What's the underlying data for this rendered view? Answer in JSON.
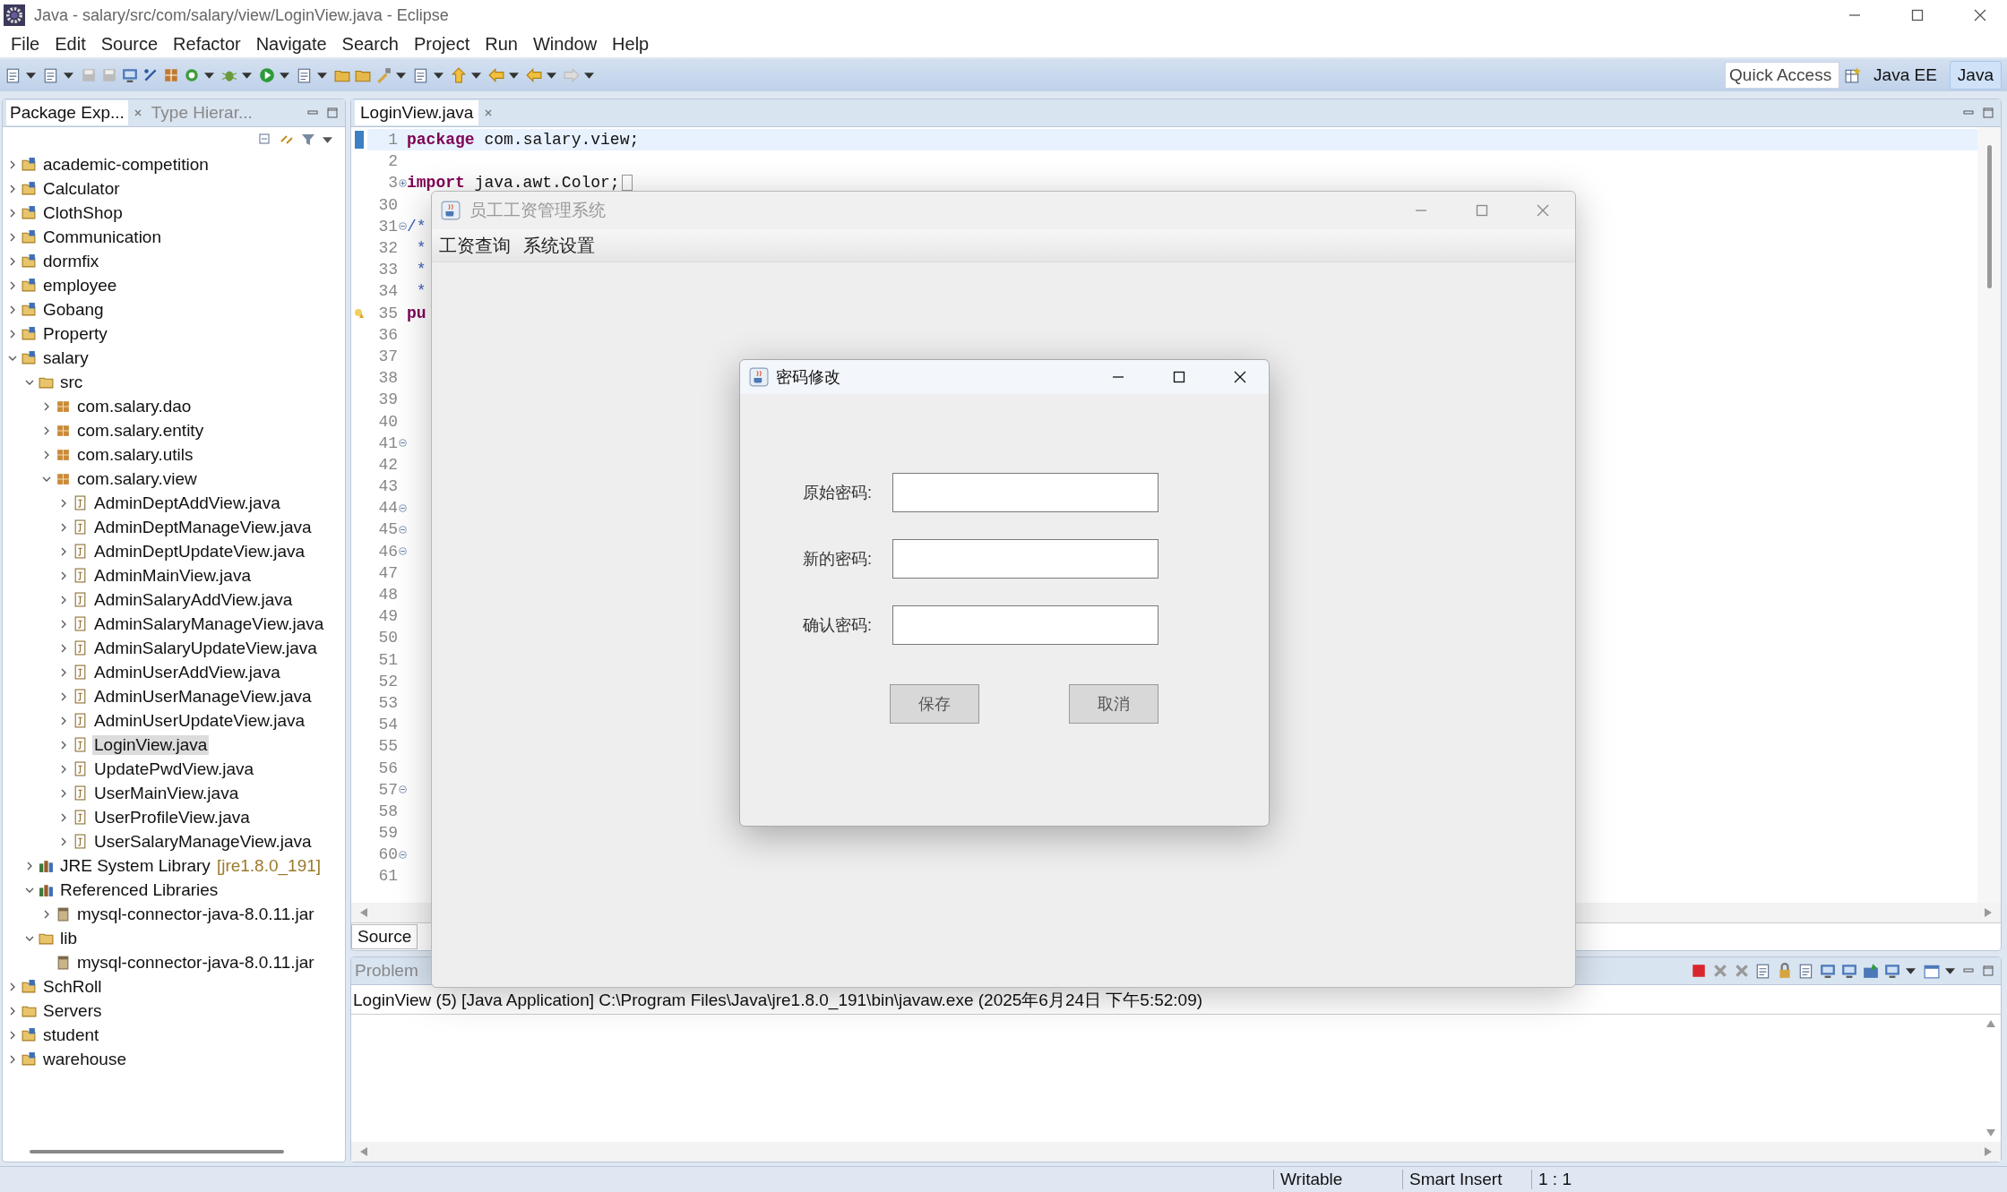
{
  "window": {
    "title": "Java - salary/src/com/salary/view/LoginView.java - Eclipse"
  },
  "menu": [
    "File",
    "Edit",
    "Source",
    "Refactor",
    "Navigate",
    "Search",
    "Project",
    "Run",
    "Window",
    "Help"
  ],
  "quick_access": {
    "placeholder": "Quick Access"
  },
  "perspectives": [
    {
      "label": "Java EE",
      "selected": false
    },
    {
      "label": "Java",
      "selected": true
    }
  ],
  "left_tabs": [
    {
      "label": "Package Exp...",
      "selected": true
    },
    {
      "label": "Type Hierar...",
      "selected": false
    }
  ],
  "tree": [
    {
      "label": "academic-competition",
      "kind": "project",
      "expanded": false,
      "selected": false
    },
    {
      "label": "Calculator",
      "kind": "project",
      "expanded": false,
      "selected": false
    },
    {
      "label": "ClothShop",
      "kind": "project",
      "expanded": false,
      "selected": false
    },
    {
      "label": "Communication",
      "kind": "project",
      "expanded": false,
      "selected": false
    },
    {
      "label": "dormfix",
      "kind": "project",
      "expanded": false,
      "selected": false
    },
    {
      "label": "employee",
      "kind": "project",
      "expanded": false,
      "selected": false
    },
    {
      "label": "Gobang",
      "kind": "project",
      "expanded": false,
      "selected": false
    },
    {
      "label": "Property",
      "kind": "project",
      "expanded": false,
      "selected": false
    },
    {
      "label": "salary",
      "kind": "project",
      "expanded": true,
      "selected": false,
      "children": [
        {
          "label": "src",
          "kind": "source",
          "expanded": true,
          "selected": false,
          "children": [
            {
              "label": "com.salary.dao",
              "kind": "package",
              "expanded": false,
              "selected": false
            },
            {
              "label": "com.salary.entity",
              "kind": "package",
              "expanded": false,
              "selected": false
            },
            {
              "label": "com.salary.utils",
              "kind": "package",
              "expanded": false,
              "selected": false
            },
            {
              "label": "com.salary.view",
              "kind": "package",
              "expanded": true,
              "selected": false,
              "children": [
                {
                  "label": "AdminDeptAddView.java",
                  "kind": "file",
                  "expanded": false,
                  "selected": false
                },
                {
                  "label": "AdminDeptManageView.java",
                  "kind": "file",
                  "expanded": false,
                  "selected": false
                },
                {
                  "label": "AdminDeptUpdateView.java",
                  "kind": "file",
                  "expanded": false,
                  "selected": false
                },
                {
                  "label": "AdminMainView.java",
                  "kind": "file",
                  "expanded": false,
                  "selected": false
                },
                {
                  "label": "AdminSalaryAddView.java",
                  "kind": "file",
                  "expanded": false,
                  "selected": false
                },
                {
                  "label": "AdminSalaryManageView.java",
                  "kind": "file",
                  "expanded": false,
                  "selected": false
                },
                {
                  "label": "AdminSalaryUpdateView.java",
                  "kind": "file",
                  "expanded": false,
                  "selected": false
                },
                {
                  "label": "AdminUserAddView.java",
                  "kind": "file",
                  "expanded": false,
                  "selected": false
                },
                {
                  "label": "AdminUserManageView.java",
                  "kind": "file",
                  "expanded": false,
                  "selected": false
                },
                {
                  "label": "AdminUserUpdateView.java",
                  "kind": "file",
                  "expanded": false,
                  "selected": false
                },
                {
                  "label": "LoginView.java",
                  "kind": "file",
                  "expanded": false,
                  "selected": true
                },
                {
                  "label": "UpdatePwdView.java",
                  "kind": "file",
                  "expanded": false,
                  "selected": false
                },
                {
                  "label": "UserMainView.java",
                  "kind": "file",
                  "expanded": false,
                  "selected": false
                },
                {
                  "label": "UserProfileView.java",
                  "kind": "file",
                  "expanded": false,
                  "selected": false
                },
                {
                  "label": "UserSalaryManageView.java",
                  "kind": "file",
                  "expanded": false,
                  "selected": false
                }
              ]
            }
          ]
        },
        {
          "label": "JRE System Library",
          "suffix": "[jre1.8.0_191]",
          "kind": "library",
          "expanded": false,
          "selected": false
        },
        {
          "label": "Referenced Libraries",
          "kind": "library",
          "expanded": true,
          "selected": false,
          "children": [
            {
              "label": "mysql-connector-java-8.0.11.jar",
              "kind": "jar",
              "expanded": false,
              "selected": false
            }
          ]
        },
        {
          "label": "lib",
          "kind": "folder",
          "expanded": true,
          "selected": false,
          "children": [
            {
              "label": "mysql-connector-java-8.0.11.jar",
              "kind": "jar",
              "selected": false
            }
          ]
        }
      ]
    },
    {
      "label": "SchRoll",
      "kind": "project",
      "expanded": false,
      "selected": false
    },
    {
      "label": "Servers",
      "kind": "folder",
      "expanded": false,
      "selected": false
    },
    {
      "label": "student",
      "kind": "project",
      "expanded": false,
      "selected": false
    },
    {
      "label": "warehouse",
      "kind": "project",
      "expanded": false,
      "selected": false
    }
  ],
  "editor": {
    "tab": "LoginView.java",
    "bottom_tab": "Source",
    "lines": [
      {
        "number": "1",
        "code": "**package** com.salary.view;",
        "current": true
      },
      {
        "number": "2"
      },
      {
        "number": "3",
        "code": "**import** java.awt.Color;",
        "folded": true
      },
      {
        "number": "30"
      },
      {
        "number": "31",
        "code": "/*",
        "kind": "comment",
        "folded": false
      },
      {
        "number": "32",
        "code": " *",
        "kind": "comment"
      },
      {
        "number": "33",
        "code": " *",
        "kind": "comment"
      },
      {
        "number": "34",
        "code": " *",
        "kind": "comment"
      },
      {
        "number": "35",
        "code": "**pu**",
        "warning": true
      },
      {
        "number": "36"
      },
      {
        "number": "37"
      },
      {
        "number": "38"
      },
      {
        "number": "39"
      },
      {
        "number": "40"
      },
      {
        "number": "41",
        "folded": false
      },
      {
        "number": "42"
      },
      {
        "number": "43"
      },
      {
        "number": "44",
        "folded": false
      },
      {
        "number": "45",
        "folded": false
      },
      {
        "number": "46",
        "folded": false
      },
      {
        "number": "47"
      },
      {
        "number": "48"
      },
      {
        "number": "49"
      },
      {
        "number": "50"
      },
      {
        "number": "51"
      },
      {
        "number": "52"
      },
      {
        "number": "53"
      },
      {
        "number": "54"
      },
      {
        "number": "55"
      },
      {
        "number": "56"
      },
      {
        "number": "57",
        "folded": false
      },
      {
        "number": "58"
      },
      {
        "number": "59"
      },
      {
        "number": "60",
        "folded": false
      },
      {
        "number": "61"
      }
    ]
  },
  "console": {
    "tab": "Problem",
    "label": "LoginView (5) [Java Application] C:\\Program Files\\Java\\jre1.8.0_191\\bin\\javaw.exe (2025年6月24日 下午5:52:09)"
  },
  "status_bar": [
    "Writable",
    "Smart Insert",
    "1 : 1"
  ],
  "app_window": {
    "title": "员工工资管理系统",
    "menu": [
      "工资查询",
      "系统设置"
    ],
    "dialog": {
      "title": "密码修改",
      "fields": [
        {
          "label": "原始密码:"
        },
        {
          "label": "新的密码:"
        },
        {
          "label": "确认密码:"
        }
      ],
      "buttons": [
        "保存",
        "取消"
      ]
    }
  }
}
